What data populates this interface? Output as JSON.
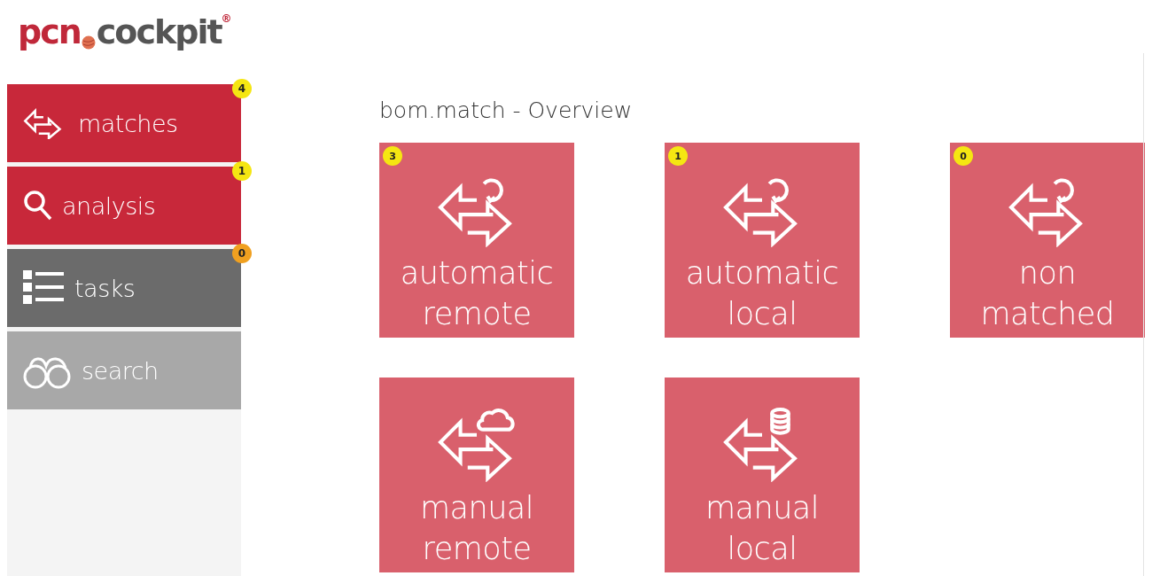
{
  "logo": {
    "left": "pcn",
    "right": "cockpit",
    "mark": "®"
  },
  "sidebar": {
    "items": [
      {
        "label": "matches",
        "kind": "arrows",
        "color": "#c8283a",
        "badge": {
          "count": "4",
          "color": "#f5e612"
        }
      },
      {
        "label": "analysis",
        "kind": "magnifier",
        "color": "#c8283a",
        "badge": {
          "count": "1",
          "color": "#f5e612"
        }
      },
      {
        "label": "tasks",
        "kind": "list",
        "color": "#6b6b6b",
        "badge": {
          "count": "0",
          "color": "#f0a020"
        }
      },
      {
        "label": "search",
        "kind": "binoculars",
        "color": "#a8a8a8"
      }
    ]
  },
  "title": "bom.match - Overview",
  "tiles": [
    {
      "lines": [
        "automatic",
        "remote"
      ],
      "kind": "refresh",
      "badge": "3"
    },
    {
      "lines": [
        "automatic",
        "local"
      ],
      "kind": "refresh",
      "badge": "1"
    },
    {
      "lines": [
        "non",
        "matched"
      ],
      "kind": "refresh",
      "badge": "0"
    },
    {
      "lines": [
        "manual",
        "remote"
      ],
      "kind": "cloud"
    },
    {
      "lines": [
        "manual",
        "local"
      ],
      "kind": "database"
    }
  ]
}
